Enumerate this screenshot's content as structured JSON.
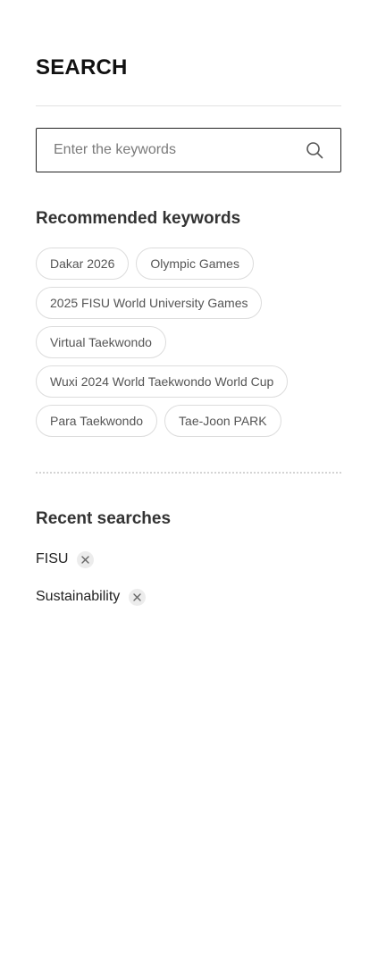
{
  "header": {
    "title": "SEARCH"
  },
  "search": {
    "placeholder": "Enter the keywords",
    "icon": "search-icon"
  },
  "recommended": {
    "title": "Recommended keywords",
    "keywords": [
      "Dakar 2026",
      "Olympic Games",
      "2025 FISU World University Games",
      "Virtual Taekwondo",
      "Wuxi 2024 World Taekwondo World Cup",
      "Para Taekwondo",
      "Tae-Joon PARK"
    ]
  },
  "recent": {
    "title": "Recent searches",
    "items": [
      "FISU",
      "Sustainability"
    ],
    "remove_icon": "close-icon"
  },
  "colors": {
    "text": "#111111",
    "muted": "#555555",
    "border": "#dcdcdc",
    "chip_remove_bg": "#ececec"
  }
}
